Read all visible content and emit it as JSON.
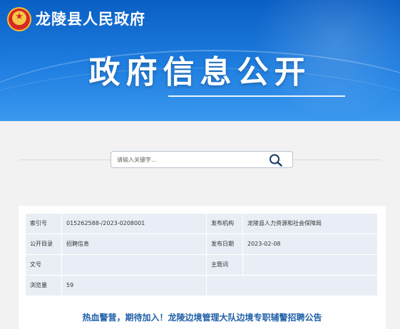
{
  "header": {
    "site_name": "龙陵县人民政府",
    "emblem_icon": "national-emblem-icon",
    "hero_title": "政府信息公开"
  },
  "search": {
    "placeholder": "请输入关键字...",
    "icon": "search-icon"
  },
  "info": {
    "rows": [
      [
        {
          "label": "索引号",
          "value": "015262588-/2023-0208001"
        },
        {
          "label": "发布机构",
          "value": "龙陵县人力资源和社会保障局"
        }
      ],
      [
        {
          "label": "公开目录",
          "value": "招聘信息"
        },
        {
          "label": "发布日期",
          "value": "2023-02-08"
        }
      ],
      [
        {
          "label": "文号",
          "value": ""
        },
        {
          "label": "主题词",
          "value": ""
        }
      ],
      [
        {
          "label": "浏览量",
          "value": "59"
        }
      ]
    ]
  },
  "article": {
    "title": "热血警营，期待加入！龙陵边境管理大队边境专职辅警招聘公告"
  },
  "colors": {
    "banner_blue": "#1f7ee0",
    "table_cell": "#e9eef6",
    "title_blue": "#1f5fa8"
  }
}
